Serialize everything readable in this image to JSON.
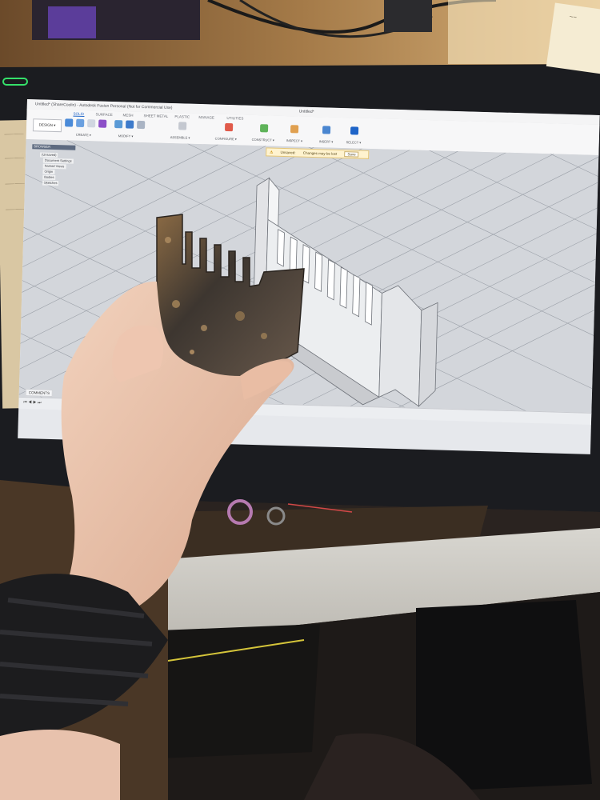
{
  "app": {
    "window_title": "Untitled* (ShareCoolin) - Autodesk Fusion Personal (Not for Commercial Use)",
    "document_tab": "Untitled*"
  },
  "ribbon": {
    "workspace_button": "DESIGN ▾",
    "tabs": [
      {
        "label": "SOLID",
        "active": true
      },
      {
        "label": "SURFACE",
        "active": false
      },
      {
        "label": "MESH",
        "active": false
      },
      {
        "label": "SHEET METAL",
        "active": false
      },
      {
        "label": "PLASTIC",
        "active": false
      },
      {
        "label": "MANAGE",
        "active": false
      },
      {
        "label": "UTILITIES",
        "active": false
      }
    ],
    "groups": [
      {
        "label": "CREATE ▾"
      },
      {
        "label": "MODIFY ▾"
      },
      {
        "label": "ASSEMBLE ▾"
      },
      {
        "label": "CONFIGURE ▾"
      },
      {
        "label": "CONSTRUCT ▾"
      },
      {
        "label": "INSPECT ▾"
      },
      {
        "label": "INSERT ▾"
      },
      {
        "label": "SELECT ▾"
      }
    ]
  },
  "notice": {
    "label": "Unsaved:",
    "message": "Changes may be lost",
    "action": "Save"
  },
  "browser": {
    "header": "BROWSER",
    "items": [
      {
        "label": "(Unsaved)"
      },
      {
        "label": "Document Settings"
      },
      {
        "label": "Named Views"
      },
      {
        "label": "Origin"
      },
      {
        "label": "Bodies"
      },
      {
        "label": "Sketches"
      }
    ]
  },
  "comments": {
    "label": "COMMENTS"
  },
  "colors": {
    "accent_blue": "#1e64c8",
    "model_body": "#e8e9ec",
    "grid_line": "#9ba0a8",
    "viewport_bg": "#d3d6db",
    "rust": "#6a4d33"
  }
}
